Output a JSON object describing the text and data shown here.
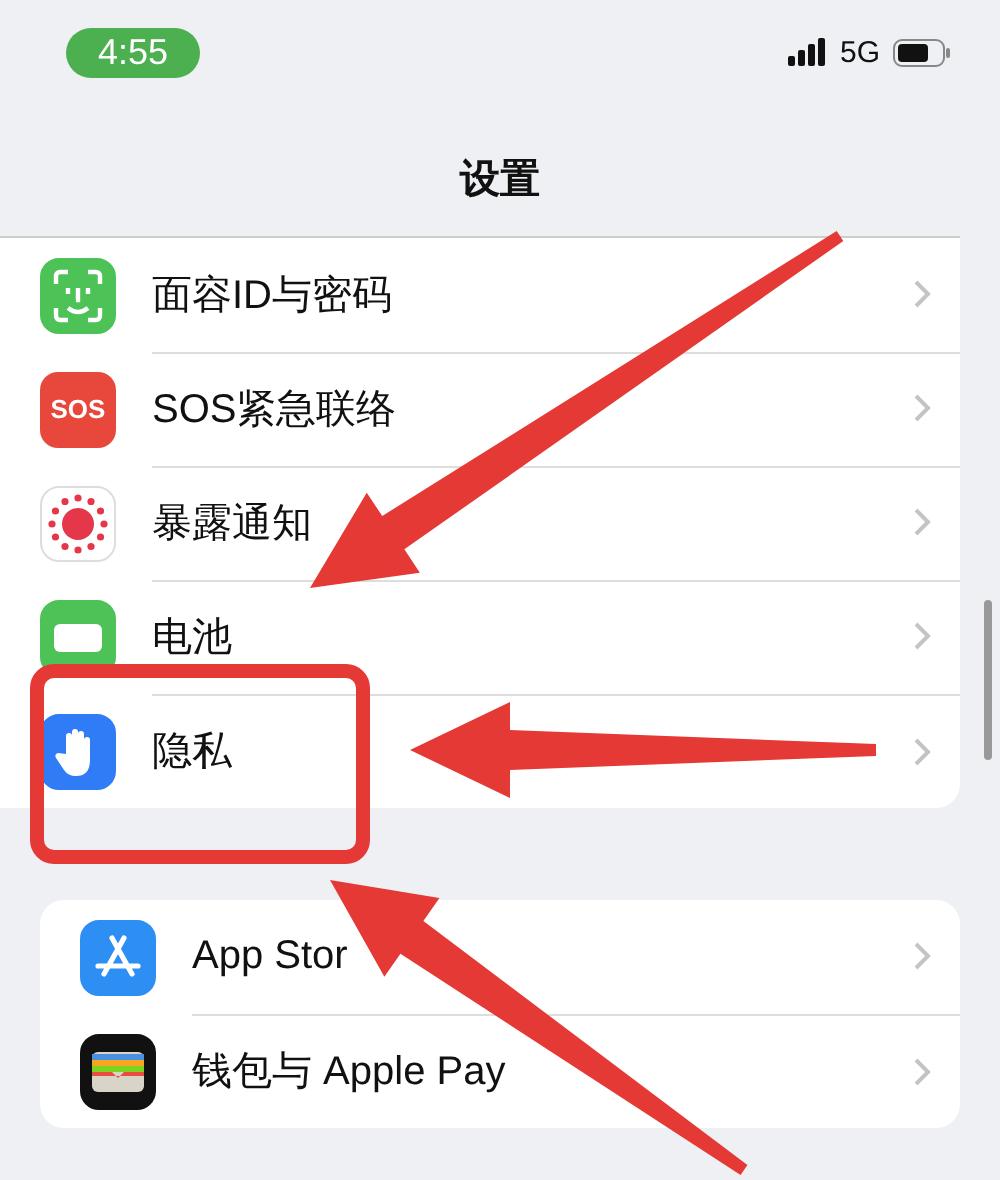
{
  "status_bar": {
    "time": "4:55",
    "network": "5G"
  },
  "title": "设置",
  "groups": [
    {
      "items": [
        {
          "kind": "faceid",
          "label": "面容ID与密码",
          "highlighted": false
        },
        {
          "kind": "sos",
          "label": "SOS紧急联络",
          "icon_text": "SOS",
          "highlighted": false
        },
        {
          "kind": "exposure",
          "label": "暴露通知",
          "highlighted": false
        },
        {
          "kind": "battery",
          "label": "电池",
          "highlighted": false
        },
        {
          "kind": "privacy",
          "label": "隐私",
          "highlighted": true
        }
      ]
    },
    {
      "items": [
        {
          "kind": "appstore",
          "label": "App Stor",
          "highlighted": false
        },
        {
          "kind": "wallet",
          "label": "钱包与 Apple Pay",
          "highlighted": false
        }
      ]
    }
  ]
}
